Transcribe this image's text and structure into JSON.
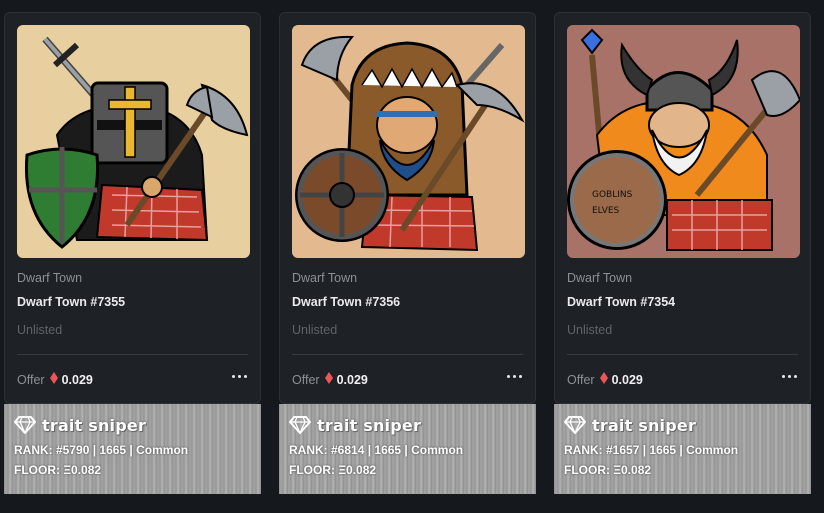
{
  "cards": [
    {
      "collection": "Dwarf Town",
      "title": "Dwarf Town #7355",
      "status": "Unlisted",
      "offer_label": "Offer",
      "offer_value": "0.029",
      "bg_color": "#e8cf9f"
    },
    {
      "collection": "Dwarf Town",
      "title": "Dwarf Town #7356",
      "status": "Unlisted",
      "offer_label": "Offer",
      "offer_value": "0.029",
      "bg_color": "#e3b98f"
    },
    {
      "collection": "Dwarf Town",
      "title": "Dwarf Town #7354",
      "status": "Unlisted",
      "offer_label": "Offer",
      "offer_value": "0.029",
      "bg_color": "#a87268"
    }
  ],
  "snipers": [
    {
      "brand": "trait sniper",
      "rank": "RANK: #5790 | 1665 | Common",
      "floor": "FLOOR: Ξ0.082"
    },
    {
      "brand": "trait sniper",
      "rank": "RANK: #6814 | 1665 | Common",
      "floor": "FLOOR: Ξ0.082"
    },
    {
      "brand": "trait sniper",
      "rank": "RANK: #1657 | 1665 | Common",
      "floor": "FLOOR: Ξ0.082"
    }
  ],
  "colors": {
    "eth_red": "#eb5757",
    "card_bg": "#1e2226",
    "page_bg": "#15181c"
  },
  "icons": {
    "eth": "ethereum-icon",
    "menu": "more-options-icon",
    "brand": "diamond-icon"
  }
}
